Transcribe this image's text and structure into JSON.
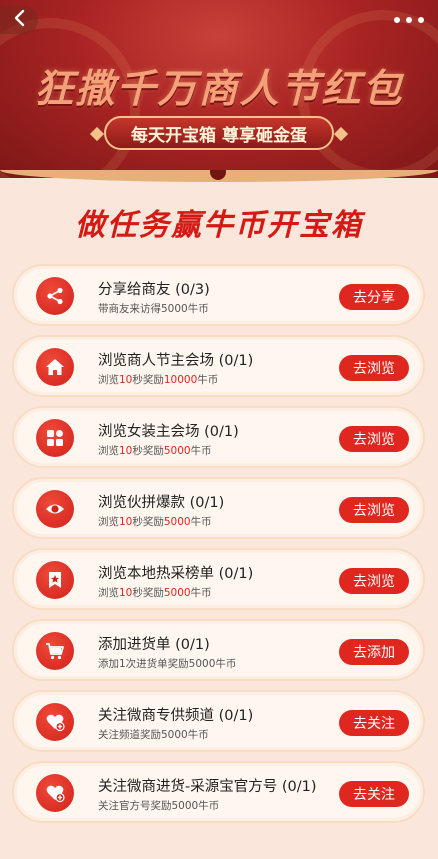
{
  "header": {
    "back_icon": "chevron-left-icon",
    "more_icon": "more-dots-icon"
  },
  "banner": {
    "title": "狂撒千万商人节红包",
    "subtitle": "每天开宝箱 尊享砸金蛋"
  },
  "section": {
    "title": "做任务赢牛币开宝箱"
  },
  "colors": {
    "accent": "#df2720",
    "title_red": "#d41a14",
    "background": "#fbe6dc"
  },
  "tasks": [
    {
      "icon": "share-icon",
      "title": "分享给商友 (0/3)",
      "desc_pre": "带商友来访得5000牛币",
      "desc_highlight1": "",
      "desc_mid": "",
      "desc_highlight2": "",
      "desc_post": "",
      "button": "去分享"
    },
    {
      "icon": "home-icon",
      "title": "浏览商人节主会场 (0/1)",
      "desc_pre": "浏览",
      "desc_highlight1": "10",
      "desc_mid": "秒奖励",
      "desc_highlight2": "10000",
      "desc_post": "牛币",
      "button": "去浏览"
    },
    {
      "icon": "grid-icon",
      "title": "浏览女装主会场 (0/1)",
      "desc_pre": "浏览",
      "desc_highlight1": "10",
      "desc_mid": "秒奖励",
      "desc_highlight2": "5000",
      "desc_post": "牛币",
      "button": "去浏览"
    },
    {
      "icon": "eye-icon",
      "title": "浏览伙拼爆款 (0/1)",
      "desc_pre": "浏览",
      "desc_highlight1": "10",
      "desc_mid": "秒奖励",
      "desc_highlight2": "5000",
      "desc_post": "牛币",
      "button": "去浏览"
    },
    {
      "icon": "star-bookmark-icon",
      "title": "浏览本地热采榜单 (0/1)",
      "desc_pre": "浏览",
      "desc_highlight1": "10",
      "desc_mid": "秒奖励",
      "desc_highlight2": "5000",
      "desc_post": "牛币",
      "button": "去浏览"
    },
    {
      "icon": "cart-icon",
      "title": "添加进货单 (0/1)",
      "desc_pre": "添加1次进货单奖励5000牛币",
      "desc_highlight1": "",
      "desc_mid": "",
      "desc_highlight2": "",
      "desc_post": "",
      "button": "去添加"
    },
    {
      "icon": "heart-plus-icon",
      "title": "关注微商专供频道 (0/1)",
      "desc_pre": "关注频道奖励5000牛币",
      "desc_highlight1": "",
      "desc_mid": "",
      "desc_highlight2": "",
      "desc_post": "",
      "button": "去关注"
    },
    {
      "icon": "heart-plus-icon",
      "title": "关注微商进货-采源宝官方号 (0/1)",
      "desc_pre": "关注官方号奖励5000牛币",
      "desc_highlight1": "",
      "desc_mid": "",
      "desc_highlight2": "",
      "desc_post": "",
      "button": "去关注"
    }
  ]
}
